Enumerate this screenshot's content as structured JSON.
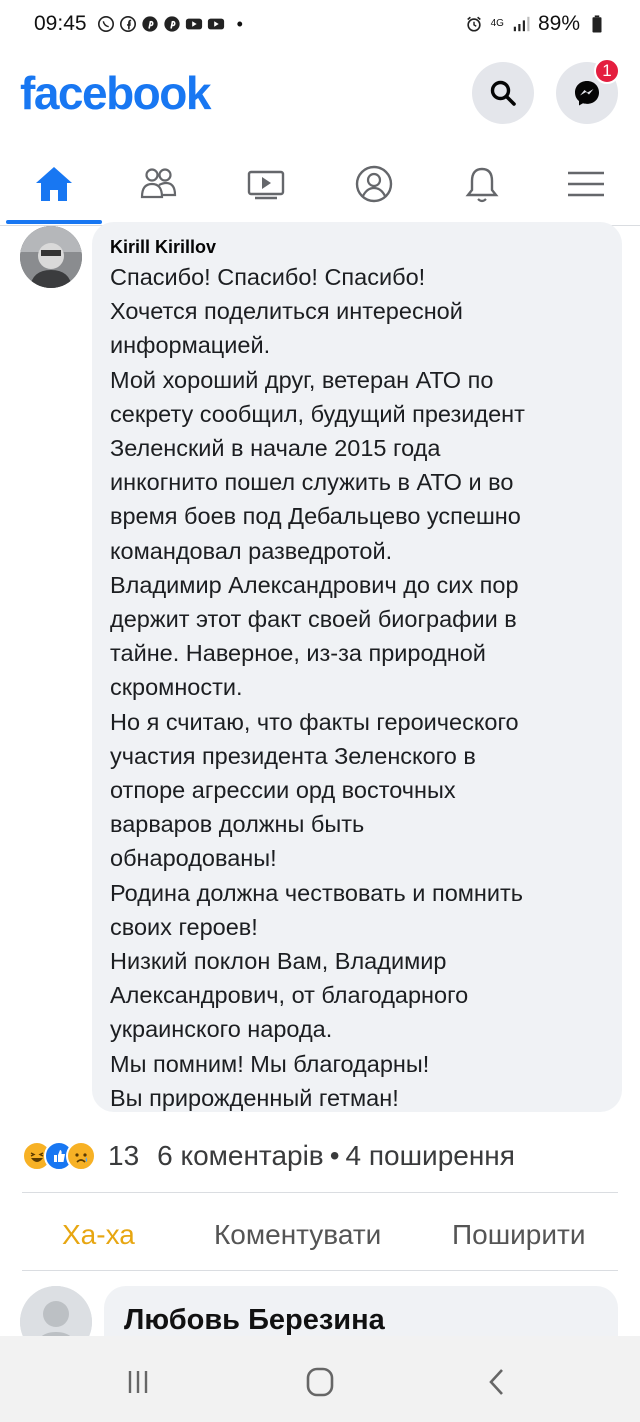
{
  "status_bar": {
    "time": "09:45",
    "network": "4G",
    "battery": "89%",
    "left_icons": [
      "whatsapp-icon",
      "facebook-icon",
      "pinterest-icon",
      "pinterest-icon",
      "youtube-icon",
      "youtube-icon"
    ],
    "right_icons": [
      "alarm-icon",
      "signal-icon",
      "battery-icon"
    ]
  },
  "header": {
    "logo": "facebook",
    "messenger_badge": "1",
    "brand_color": "#1877f2"
  },
  "nav": {
    "items": [
      {
        "name": "home",
        "icon": "home-icon",
        "active": true
      },
      {
        "name": "friends",
        "icon": "friends-icon",
        "active": false
      },
      {
        "name": "watch",
        "icon": "video-icon",
        "active": false
      },
      {
        "name": "profile",
        "icon": "profile-icon",
        "active": false
      },
      {
        "name": "notifications",
        "icon": "bell-icon",
        "active": false
      },
      {
        "name": "menu",
        "icon": "hamburger-menu-icon",
        "active": false
      }
    ]
  },
  "comment": {
    "author": "Kirill Kirillov",
    "lines": [
      "Спасибо! Спасибо! Спасибо!",
      "Хочется поделиться интересной",
      "информацией.",
      "Мой хороший друг, ветеран АТО по",
      "секрету сообщил, будущий президент",
      "Зеленский в начале 2015 года",
      "инкогнито пошел служить в АТО и во",
      "время боев под Дебальцево успешно",
      "командовал разведротой.",
      "Владимир Александрович до сих пор",
      "держит этот факт своей биографии в",
      "тайне. Наверное, из-за природной",
      "скромности.",
      "Но я считаю, что факты героического",
      "участия президента Зеленского в",
      "отпоре агрессии орд восточных",
      "варваров должны быть",
      "обнародованы!",
      "Родина должна чествовать и помнить",
      "своих героев!",
      "Низкий поклон Вам, Владимир",
      "Александрович, от благодарного",
      "украинского народа.",
      "Мы помним! Мы благодарны!",
      "Вы прирожденный гетман!"
    ]
  },
  "stats": {
    "reactions": [
      "haha-icon",
      "like-icon",
      "sad-icon"
    ],
    "count": "13",
    "comments": "6 коментарів",
    "separator": "•",
    "shares": "4 поширення"
  },
  "actions": {
    "reaction_label": "Ха-ха",
    "reaction_color": "#e7a611",
    "comment_label": "Коментувати",
    "share_label": "Поширити"
  },
  "next_comment": {
    "author": "Любовь Березина"
  },
  "system_nav": {
    "buttons": [
      "recent-apps-icon",
      "home-button-icon",
      "back-icon"
    ]
  }
}
